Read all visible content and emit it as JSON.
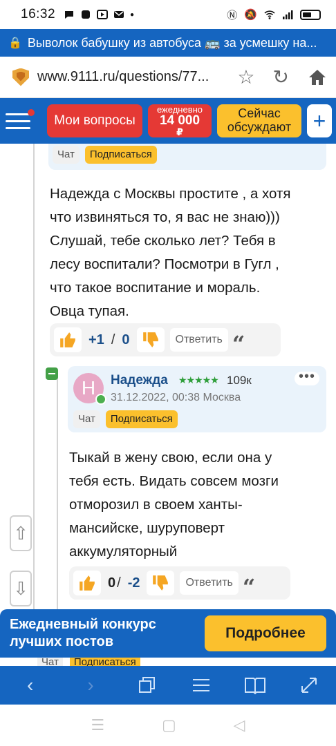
{
  "status_bar": {
    "time": "16:32"
  },
  "page_title": "Выволок бабушку из автобуса 🚌 за усмешку на...",
  "url": "www.9111.ru/questions/77...",
  "header": {
    "my_questions": "Мои вопросы",
    "daily_small": "ежедневно",
    "daily_amount": "14 000",
    "daily_currency": "₽",
    "discussing_line1": "Сейчас",
    "discussing_line2": "обсуждают",
    "plus": "+"
  },
  "chips": {
    "chat": "Чат",
    "subscribe": "Подписаться"
  },
  "comments": [
    {
      "text_lines": [
        "Надежда с Москвы простите , а хотя",
        "что извиняться то, я вас не знаю)))",
        "Слушай, тебе сколько лет? Тебя в",
        "лесу воспитали? Посмотри в Гугл ,",
        "что такое воспитание и мораль.",
        "Овца тупая."
      ],
      "up": "+1",
      "sep": "/",
      "down": "0",
      "reply": "Ответить"
    },
    {
      "author": "Надежда",
      "avatar_letter": "Н",
      "stars": "★★★★★",
      "rating": "109к",
      "date": "31.12.2022, 00:38",
      "city": "Москва",
      "text_lines": [
        "Тыкай в жену свою, если она у",
        "тебя есть. Видать совсем мозги",
        "отморозил в своем ханты-",
        "мансийске, шуруповерт",
        "аккумуляторный"
      ],
      "up": "0",
      "sep": "/",
      "down": "-2",
      "reply": "Ответить"
    }
  ],
  "banner": {
    "line1": "Ежедневный конкурс",
    "line2": "лучших постов",
    "button": "Подробнее"
  },
  "colors": {
    "brand_blue": "#1565c0",
    "accent_red": "#e53935",
    "accent_yellow": "#fbc02d",
    "thumb_orange": "#f5a623",
    "card_bg": "#eaf3fb"
  }
}
